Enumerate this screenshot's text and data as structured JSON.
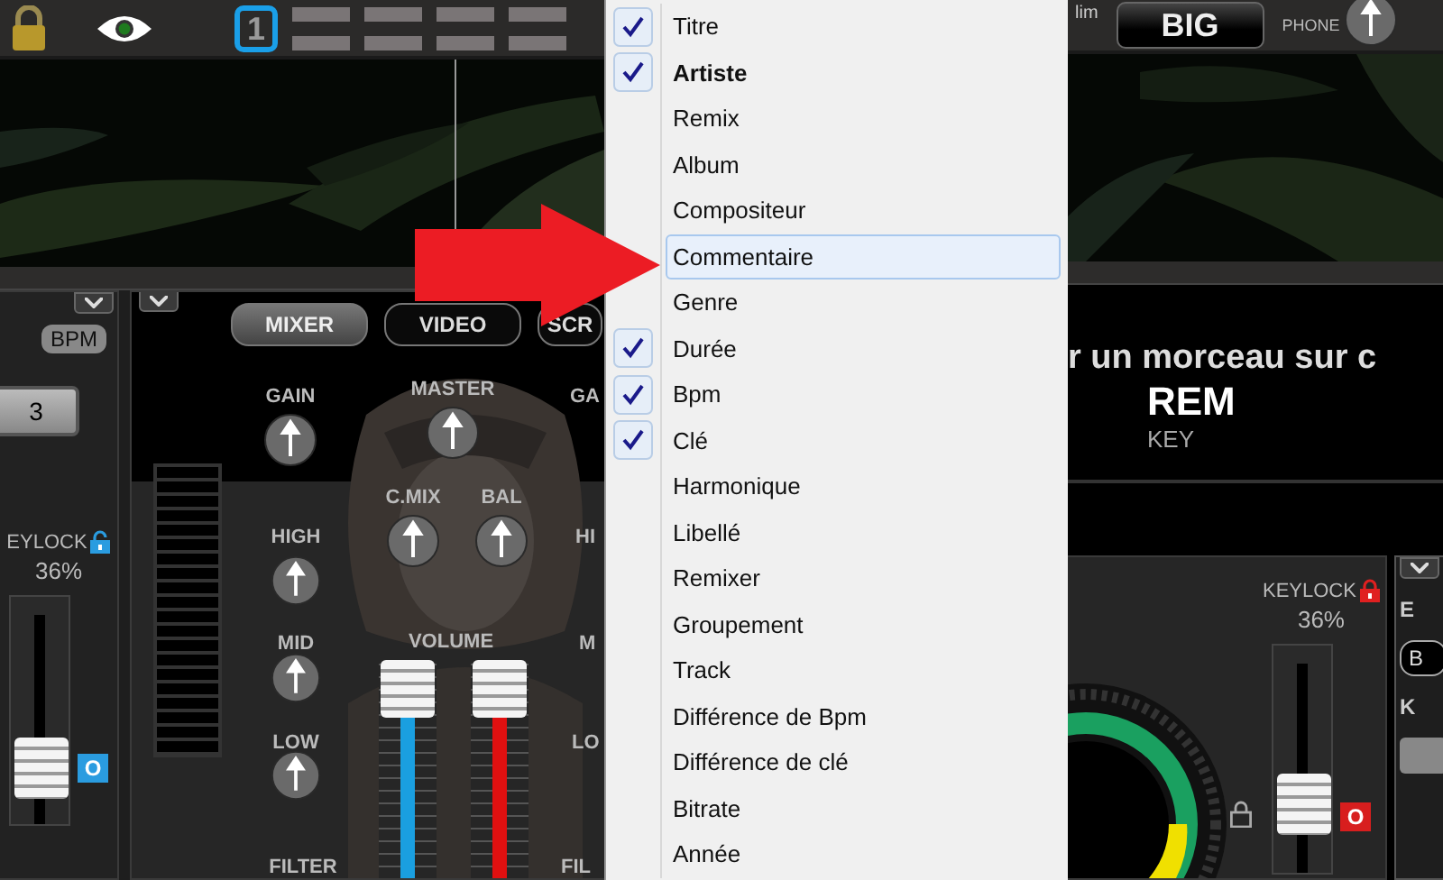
{
  "top_bar": {
    "deck_number": "1",
    "lim_label": "lim",
    "big_button": "BIG",
    "phone_label": "PHONE"
  },
  "left_deck": {
    "bpm_badge": "BPM",
    "pitch_button": "3",
    "keylock_label": "EYLOCK",
    "pitch_percent": "36%",
    "pitch_slider": {
      "level": 0.17
    },
    "badge": "O"
  },
  "mixer": {
    "tabs": [
      {
        "label": "MIXER",
        "selected": true
      },
      {
        "label": "VIDEO",
        "selected": false
      },
      {
        "label": "SCR",
        "selected": false
      }
    ],
    "knobs": [
      {
        "label": "GAIN"
      },
      {
        "label": "MASTER"
      },
      {
        "label": "C.MIX"
      },
      {
        "label": "BAL"
      },
      {
        "label": "HIGH"
      },
      {
        "label": "MID"
      },
      {
        "label": "LOW"
      }
    ],
    "cut_labels": [
      "GA",
      "HI",
      "M",
      "LO",
      "FIL"
    ],
    "volume_label": "VOLUME",
    "filter_label": "FILTER",
    "faders": [
      {
        "level": 0.96,
        "color": "#1a9fe0"
      },
      {
        "level": 0.96,
        "color": "#e01010"
      }
    ]
  },
  "right_deck": {
    "title_text": "r un morceau sur c",
    "key_value": "REM",
    "key_label": "KEY",
    "keylock_label": "KEYLOCK",
    "pitch_percent": "36%",
    "pitch_slider": {
      "level": 0.25
    },
    "badge": "O",
    "side_labels": [
      "E",
      "B",
      "K"
    ]
  },
  "context_menu": {
    "items": [
      {
        "label": "Titre",
        "checked": true,
        "bold": false,
        "selected": false
      },
      {
        "label": "Artiste",
        "checked": true,
        "bold": true,
        "selected": false
      },
      {
        "label": "Remix",
        "checked": false,
        "bold": false,
        "selected": false
      },
      {
        "label": "Album",
        "checked": false,
        "bold": false,
        "selected": false
      },
      {
        "label": "Compositeur",
        "checked": false,
        "bold": false,
        "selected": false
      },
      {
        "label": "Commentaire",
        "checked": false,
        "bold": false,
        "selected": true
      },
      {
        "label": "Genre",
        "checked": false,
        "bold": false,
        "selected": false
      },
      {
        "label": "Durée",
        "checked": true,
        "bold": false,
        "selected": false
      },
      {
        "label": "Bpm",
        "checked": true,
        "bold": false,
        "selected": false
      },
      {
        "label": "Clé",
        "checked": true,
        "bold": false,
        "selected": false
      },
      {
        "label": "Harmonique",
        "checked": false,
        "bold": false,
        "selected": false
      },
      {
        "label": "Libellé",
        "checked": false,
        "bold": false,
        "selected": false
      },
      {
        "label": "Remixer",
        "checked": false,
        "bold": false,
        "selected": false
      },
      {
        "label": "Groupement",
        "checked": false,
        "bold": false,
        "selected": false
      },
      {
        "label": "Track",
        "checked": false,
        "bold": false,
        "selected": false
      },
      {
        "label": "Différence de Bpm",
        "checked": false,
        "bold": false,
        "selected": false
      },
      {
        "label": "Différence de clé",
        "checked": false,
        "bold": false,
        "selected": false
      },
      {
        "label": "Bitrate",
        "checked": false,
        "bold": false,
        "selected": false
      },
      {
        "label": "Année",
        "checked": false,
        "bold": false,
        "selected": false
      }
    ]
  }
}
